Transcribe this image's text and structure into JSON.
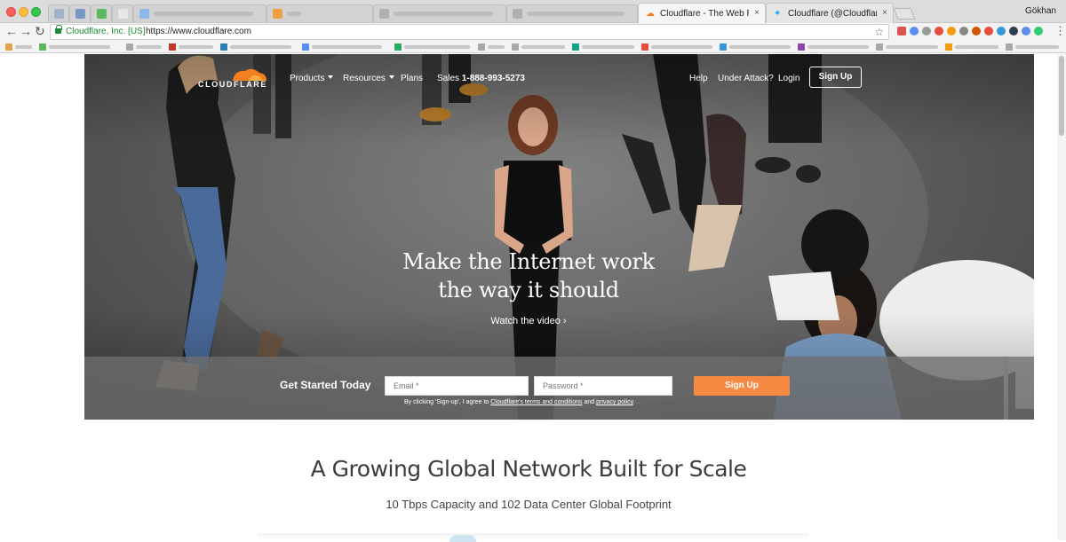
{
  "browser": {
    "active_tab_title": "Cloudflare - The Web Performa",
    "second_tab_title": "Cloudflare (@Cloudflare) | Twi",
    "tab_close": "×",
    "profile_name": "Gökhan",
    "site_identity": "Cloudflare, Inc. [US]",
    "url": "https://www.cloudflare.com",
    "bookmark_star": "☆",
    "menu_dots": "⋮",
    "back_glyph": "←",
    "forward_glyph": "→",
    "reload_glyph": "↻"
  },
  "header": {
    "logo_text": "CLOUDFLARE",
    "nav": {
      "products": "Products",
      "resources": "Resources",
      "plans": "Plans",
      "sales_label": "Sales",
      "sales_phone": "1-888-993-5273",
      "help": "Help",
      "under_attack": "Under Attack?",
      "login": "Login",
      "sign_up": "Sign Up"
    }
  },
  "hero": {
    "headline_line1": "Make the Internet work",
    "headline_line2": "the way it should",
    "watch_video": "Watch the video ›"
  },
  "signup_form": {
    "label": "Get Started Today",
    "email_placeholder": "Email *",
    "password_placeholder": "Password *",
    "button": "Sign Up",
    "legal_prefix": "By clicking 'Sign-up', I agree to",
    "terms_link": "Cloudflare's terms and conditions",
    "legal_and": "and",
    "privacy_link": "privacy policy",
    "legal_end": "."
  },
  "section": {
    "title": "A Growing Global Network Built for Scale",
    "subtitle": "10 Tbps Capacity and 102 Data Center Global Footprint"
  },
  "colors": {
    "brand_orange": "#f38020",
    "signup_button": "#f68a43",
    "secure_green": "#1c8c30"
  }
}
